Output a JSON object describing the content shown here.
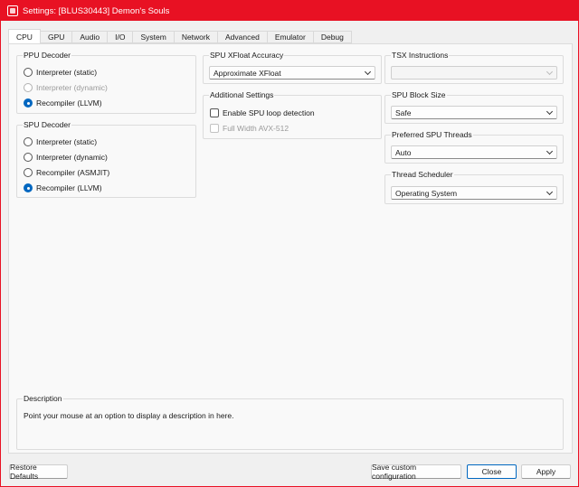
{
  "window": {
    "title": "Settings: [BLUS30443] Demon's Souls",
    "accent": "#e81123"
  },
  "tabs": [
    {
      "label": "CPU",
      "active": true
    },
    {
      "label": "GPU"
    },
    {
      "label": "Audio"
    },
    {
      "label": "I/O"
    },
    {
      "label": "System"
    },
    {
      "label": "Network"
    },
    {
      "label": "Advanced"
    },
    {
      "label": "Emulator"
    },
    {
      "label": "Debug"
    }
  ],
  "ppu_decoder": {
    "title": "PPU Decoder",
    "options": [
      "Interpreter (static)",
      "Interpreter (dynamic)",
      "Recompiler (LLVM)"
    ],
    "selected": "Recompiler (LLVM)"
  },
  "spu_decoder": {
    "title": "SPU Decoder",
    "options": [
      "Interpreter (static)",
      "Interpreter (dynamic)",
      "Recompiler (ASMJIT)",
      "Recompiler (LLVM)"
    ],
    "selected": "Recompiler (LLVM)"
  },
  "spu_xfloat": {
    "title": "SPU XFloat Accuracy",
    "value": "Approximate XFloat"
  },
  "additional": {
    "title": "Additional Settings",
    "loop_detection": "Enable SPU loop detection",
    "avx512": "Full Width AVX-512"
  },
  "tsx": {
    "title": "TSX Instructions",
    "value": ""
  },
  "spu_block": {
    "title": "SPU Block Size",
    "value": "Safe"
  },
  "spu_threads": {
    "title": "Preferred SPU Threads",
    "value": "Auto"
  },
  "scheduler": {
    "title": "Thread Scheduler",
    "value": "Operating System"
  },
  "description": {
    "title": "Description",
    "text": "Point your mouse at an option to display a description in here."
  },
  "buttons": {
    "restore": "Restore Defaults",
    "save_custom": "Save custom configuration",
    "close": "Close",
    "apply": "Apply"
  },
  "colors": {
    "radio_checked": "#0067c0"
  }
}
